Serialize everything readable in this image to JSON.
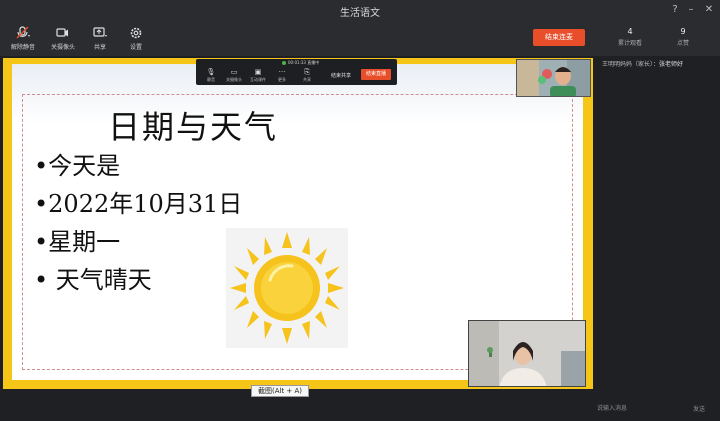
{
  "window": {
    "title": "生活语文"
  },
  "toolbar": {
    "unmute_label": "解除静音",
    "camera_label": "关摄像头",
    "share_label": "共享",
    "settings_label": "设置",
    "end_button": "结束连麦",
    "stats": [
      {
        "value": "4",
        "label": "累计观看"
      },
      {
        "value": "9",
        "label": "点赞"
      }
    ]
  },
  "mini_bar": {
    "status": "00:01:33  直播中",
    "tools": [
      {
        "icon": "microphone-icon",
        "label": "静音"
      },
      {
        "icon": "camera-icon",
        "label": "关摄像头"
      },
      {
        "icon": "window-icon",
        "label": "互动课件"
      },
      {
        "icon": "more-icon",
        "label": "更多"
      },
      {
        "icon": "share-icon",
        "label": "共享"
      }
    ],
    "end_share_label": "结束共享",
    "end_live_label": "结束直播"
  },
  "slide": {
    "title": "日期与天气",
    "bullets": [
      "•今天是",
      "•2022年10月31日",
      "•星期一",
      "• 天气晴天"
    ]
  },
  "chat": {
    "messages": [
      {
        "sender": "王明明妈妈（家长）：",
        "text": "张老师好"
      }
    ],
    "input_placeholder": "说输入消息",
    "send_label": "发送"
  },
  "tooltip": {
    "text": "截图(Alt + A)"
  },
  "colors": {
    "accent_end_button": "#e84e2a",
    "slide_border": "#f5c518",
    "sun": "#f6c21c"
  }
}
